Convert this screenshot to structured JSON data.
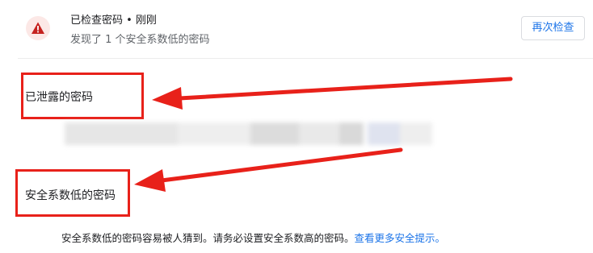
{
  "header": {
    "title": "已检查密码 • 刚刚",
    "subtitle": "发现了 1 个安全系数低的密码",
    "recheck_label": "再次检查",
    "icon": "warning-triangle-icon",
    "icon_color": "#c5221f"
  },
  "sections": {
    "leaked_title": "已泄露的密码",
    "weak_title": "安全系数低的密码"
  },
  "info": {
    "text": "安全系数低的密码容易被人猜到。请务必设置安全系数高的密码。",
    "link_text": "查看更多安全提示。"
  },
  "annotation": {
    "color": "#e8211a"
  }
}
